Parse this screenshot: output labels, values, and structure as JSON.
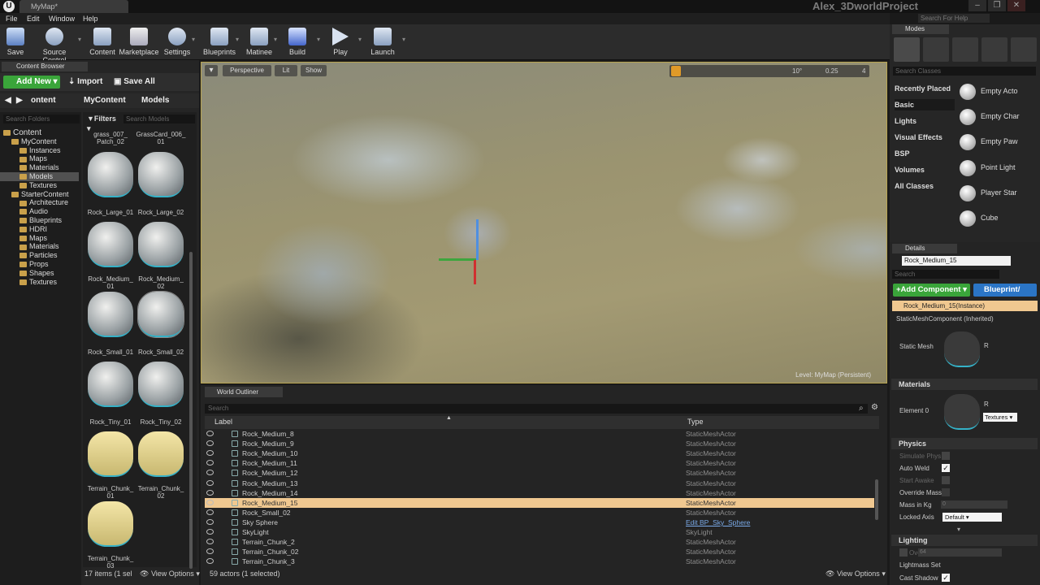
{
  "window": {
    "map_tab": "MyMap*",
    "project": "Alex_3DworldProject",
    "search_help": "Search For Help",
    "controls": [
      "–",
      "❐",
      "✕"
    ]
  },
  "menu": [
    "File",
    "Edit",
    "Window",
    "Help"
  ],
  "toolbar": [
    {
      "label": "Save",
      "icon": "save-icon"
    },
    {
      "label": "Source Control",
      "icon": "source-control-icon"
    },
    {
      "label": "Content",
      "icon": "content-icon"
    },
    {
      "label": "Marketplace",
      "icon": "marketplace-icon"
    },
    {
      "label": "Settings",
      "icon": "settings-icon"
    },
    {
      "label": "Blueprints",
      "icon": "blueprints-icon"
    },
    {
      "label": "Matinee",
      "icon": "matinee-icon"
    },
    {
      "label": "Build",
      "icon": "build-icon"
    },
    {
      "label": "Play",
      "icon": "play-icon"
    },
    {
      "label": "Launch",
      "icon": "launch-icon"
    }
  ],
  "content_browser": {
    "tab": "Content Browser",
    "add_new": "Add New",
    "import": "Import",
    "save_all": "Save All",
    "path": [
      "ontent",
      "MyContent",
      "Models"
    ],
    "search_folders": "Search Folders",
    "filters": "Filters",
    "search_models": "Search Models",
    "folders": [
      {
        "label": "Content",
        "indent": 0
      },
      {
        "label": "MyContent",
        "indent": 1
      },
      {
        "label": "Instances",
        "indent": 2
      },
      {
        "label": "Maps",
        "indent": 2
      },
      {
        "label": "Materials",
        "indent": 2
      },
      {
        "label": "Models",
        "indent": 2,
        "selected": true
      },
      {
        "label": "Textures",
        "indent": 2
      },
      {
        "label": "StarterContent",
        "indent": 1
      },
      {
        "label": "Architecture",
        "indent": 2
      },
      {
        "label": "Audio",
        "indent": 2
      },
      {
        "label": "Blueprints",
        "indent": 2
      },
      {
        "label": "HDRI",
        "indent": 2
      },
      {
        "label": "Maps",
        "indent": 2
      },
      {
        "label": "Materials",
        "indent": 2
      },
      {
        "label": "Particles",
        "indent": 2
      },
      {
        "label": "Props",
        "indent": 2
      },
      {
        "label": "Shapes",
        "indent": 2
      },
      {
        "label": "Textures",
        "indent": 2
      }
    ],
    "top_labels": [
      [
        "grass_007_",
        "Patch_02"
      ],
      [
        "GrassCard_006_",
        "01"
      ]
    ],
    "assets": [
      {
        "label": [
          "Rock_Large_01"
        ],
        "kind": "rock"
      },
      {
        "label": [
          "Rock_Large_02"
        ],
        "kind": "rock"
      },
      {
        "label": [
          "Rock_Medium_",
          "01"
        ],
        "kind": "rock"
      },
      {
        "label": [
          "Rock_Medium_",
          "02"
        ],
        "kind": "rock"
      },
      {
        "label": [
          "Rock_Small_01"
        ],
        "kind": "rock"
      },
      {
        "label": [
          "Rock_Small_02"
        ],
        "kind": "rock",
        "selected": true
      },
      {
        "label": [
          "Rock_Tiny_01"
        ],
        "kind": "rock"
      },
      {
        "label": [
          "Rock_Tiny_02"
        ],
        "kind": "rock"
      },
      {
        "label": [
          "Terrain_Chunk_",
          "01"
        ],
        "kind": "terrain"
      },
      {
        "label": [
          "Terrain_Chunk_",
          "02"
        ],
        "kind": "terrain"
      },
      {
        "label": [
          "Terrain_Chunk_",
          "03"
        ],
        "kind": "terrain"
      }
    ],
    "footer": "17 items (1 sel",
    "view_options": "View Options"
  },
  "viewport": {
    "perspective": "Perspective",
    "lit": "Lit",
    "show": "Show",
    "snap_angle": "10°",
    "snap_scale": "0.25",
    "camera_speed": "4",
    "level": "Level: MyMap (Persistent)"
  },
  "world_outliner": {
    "tab": "World Outliner",
    "search": "Search",
    "col_label": "Label",
    "col_type": "Type",
    "rows": [
      {
        "name": "Rock_Medium_8",
        "type": "StaticMeshActor"
      },
      {
        "name": "Rock_Medium_9",
        "type": "StaticMeshActor"
      },
      {
        "name": "Rock_Medium_10",
        "type": "StaticMeshActor"
      },
      {
        "name": "Rock_Medium_11",
        "type": "StaticMeshActor"
      },
      {
        "name": "Rock_Medium_12",
        "type": "StaticMeshActor"
      },
      {
        "name": "Rock_Medium_13",
        "type": "StaticMeshActor"
      },
      {
        "name": "Rock_Medium_14",
        "type": "StaticMeshActor"
      },
      {
        "name": "Rock_Medium_15",
        "type": "StaticMeshActor",
        "selected": true
      },
      {
        "name": "Rock_Small_02",
        "type": "StaticMeshActor"
      },
      {
        "name": "Sky Sphere",
        "type": "Edit BP_Sky_Sphere",
        "link": true
      },
      {
        "name": "SkyLight",
        "type": "SkyLight"
      },
      {
        "name": "Terrain_Chunk_2",
        "type": "StaticMeshActor"
      },
      {
        "name": "Terrain_Chunk_02",
        "type": "StaticMeshActor"
      },
      {
        "name": "Terrain_Chunk_3",
        "type": "StaticMeshActor"
      }
    ],
    "footer": "59 actors (1 selected)",
    "view_options": "View Options"
  },
  "modes": {
    "tab": "Modes",
    "search": "Search Classes",
    "categories": [
      {
        "label": "Recently Placed"
      },
      {
        "label": "Basic",
        "active": true
      },
      {
        "label": "Lights"
      },
      {
        "label": "Visual Effects"
      },
      {
        "label": "BSP"
      },
      {
        "label": "Volumes"
      },
      {
        "label": "All Classes"
      }
    ],
    "items": [
      "Empty Acto",
      "Empty Char",
      "Empty Paw",
      "Point Light",
      "Player Star",
      "Cube"
    ]
  },
  "details": {
    "tab": "Details",
    "actor_name": "Rock_Medium_15",
    "search": "Search",
    "add_component": "+Add Component",
    "blueprint": "Blueprint/",
    "instance": "Rock_Medium_15(Instance)",
    "static_mesh_component": "StaticMeshComponent (Inherited)",
    "static_mesh_label": "Static Mesh",
    "materials_header": "Materials",
    "element0_label": "Element 0",
    "textures_dd": "Textures",
    "physics_header": "Physics",
    "simulate_physics": "Simulate Phys",
    "auto_weld": "Auto Weld",
    "start_awake": "Start Awake",
    "override_mass": "Override Mass",
    "mass_in_kg": "Mass in Kg",
    "mass_value": "0",
    "locked_axis": "Locked Axis",
    "locked_axis_value": "Default",
    "lighting_header": "Lighting",
    "overridden": "Overridden",
    "overridden_value": "64",
    "lightmass": "Lightmass Set",
    "cast_shadow": "Cast Shadow",
    "asset_abbrev": "R"
  }
}
